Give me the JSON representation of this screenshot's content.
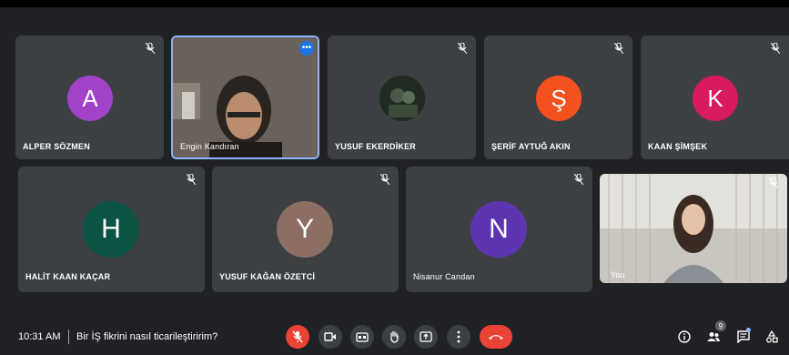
{
  "participants_row1": [
    {
      "initial": "A",
      "name": "ALPER SÖZMEN",
      "avatar_color": "#a142c8",
      "muted": true
    },
    {
      "initial": "",
      "name": "Engin Kandıran",
      "avatar_color": "",
      "muted": false,
      "video": true,
      "active": true
    },
    {
      "initial": "",
      "name": "YUSUF EKERDİKER",
      "avatar_color": "#2b3a2e",
      "muted": true,
      "photo": true
    },
    {
      "initial": "Ş",
      "name": "ŞERİF AYTUĞ AKIN",
      "avatar_color": "#f4511e",
      "muted": true
    },
    {
      "initial": "K",
      "name": "KAAN ŞİMŞEK",
      "avatar_color": "#d81b60",
      "muted": true
    }
  ],
  "participants_row2": [
    {
      "initial": "H",
      "name": "HALİT KAAN KAÇAR",
      "avatar_color": "#0b5345",
      "muted": true
    },
    {
      "initial": "Y",
      "name": "YUSUF KAĞAN ÖZETCİ",
      "avatar_color": "#8d6e63",
      "muted": true
    },
    {
      "initial": "N",
      "name": "Nisanur Candan",
      "avatar_color": "#5e35b1",
      "muted": true
    },
    {
      "initial": "",
      "name": "You",
      "avatar_color": "",
      "muted": true,
      "video": true
    }
  ],
  "bottom_bar": {
    "time": "10:31 AM",
    "separator": "|",
    "meeting_title": "Bir İŞ fikrini nasıl ticarileştiririm?",
    "participant_count": "9",
    "controls": [
      "mic-off-icon",
      "camera-icon",
      "captions-icon",
      "raise-hand-icon",
      "present-icon",
      "more-options-icon",
      "end-call-icon"
    ],
    "right_icons": [
      "info-icon",
      "people-icon",
      "chat-icon",
      "activities-icon"
    ]
  },
  "colors": {
    "background": "#202124",
    "tile": "#3c4043",
    "accent": "#8ab4f8",
    "danger": "#ea4335"
  }
}
